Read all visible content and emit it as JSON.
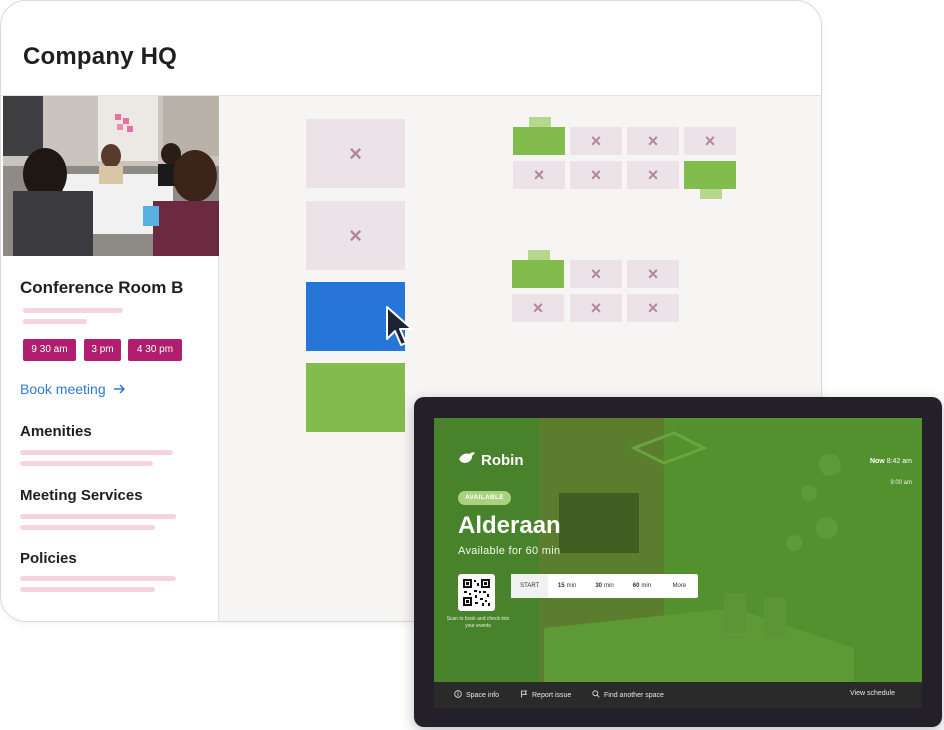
{
  "window": {
    "title": "Company HQ"
  },
  "room": {
    "title": "Conference Room B",
    "times": [
      "9 30 am",
      "3 pm",
      "4 30 pm"
    ],
    "book_label": "Book meeting",
    "sections": [
      "Amenities",
      "Meeting Services",
      "Policies"
    ]
  },
  "floor_plan": {
    "unavailable_mark": "×",
    "colors": {
      "available": "#82bc4d",
      "selected": "#2676d9",
      "unavailable": "#ebe3e7"
    }
  },
  "display": {
    "brand": "Robin",
    "now_label": "Now",
    "now_time": "8:42 am",
    "next_time": "9:00 am",
    "status_badge": "AVAILABLE",
    "room_name": "Alderaan",
    "available_for": "Available for 60 min",
    "qr_caption": "Scan to book and check into your events",
    "durations": [
      {
        "num": "",
        "unit": "START"
      },
      {
        "num": "15",
        "unit": "min"
      },
      {
        "num": "30",
        "unit": "min"
      },
      {
        "num": "60",
        "unit": "min"
      },
      {
        "num": "",
        "unit": "More"
      }
    ],
    "bottom_bar": {
      "space_info": "Space info",
      "report_issue": "Report issue",
      "find_space": "Find another space",
      "view_schedule": "View schedule"
    }
  }
}
